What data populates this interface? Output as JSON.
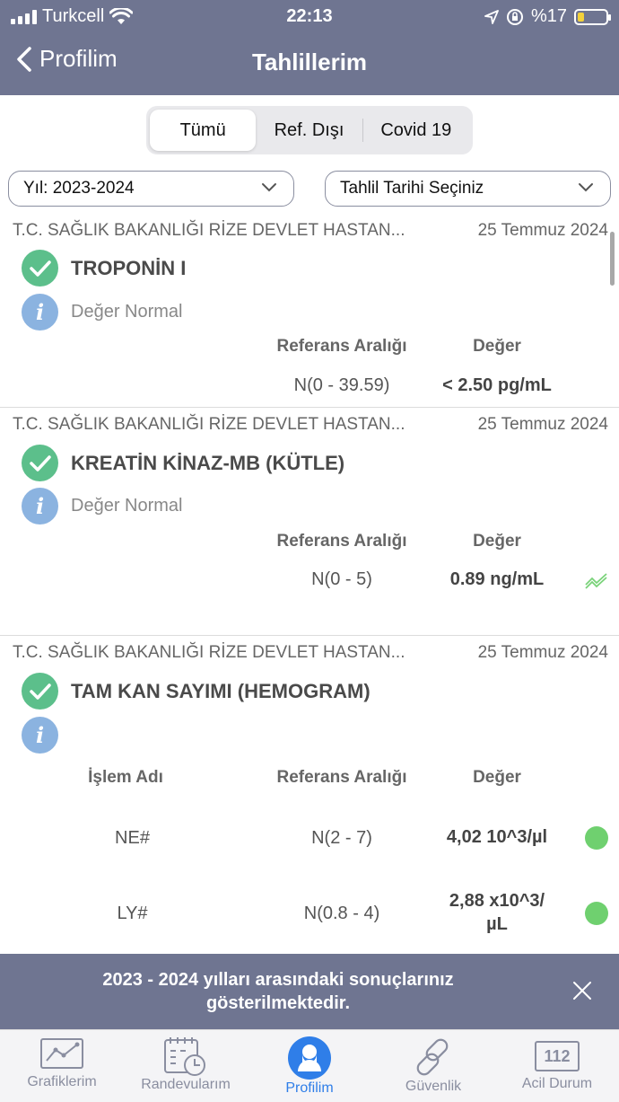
{
  "status_bar": {
    "carrier": "Turkcell",
    "time": "22:13",
    "battery": "%17"
  },
  "nav": {
    "back_label": "Profilim",
    "title": "Tahlillerim"
  },
  "segments": [
    {
      "label": "Tümü",
      "active": true
    },
    {
      "label": "Ref. Dışı",
      "active": false
    },
    {
      "label": "Covid 19",
      "active": false
    }
  ],
  "filters": {
    "year": "Yıl: 2023-2024",
    "date": "Tahlil Tarihi Seçiniz"
  },
  "results": [
    {
      "hospital": "T.C. SAĞLIK BAKANLIĞI RİZE DEVLET HASTAN...",
      "date": "25 Temmuz 2024",
      "test": "TROPONİN I",
      "status": "Değer Normal",
      "ref_header": "Referans Aralığı",
      "value_header": "Değer",
      "ref": "N(0 - 39.59)",
      "value": "< 2.50 pg/mL"
    },
    {
      "hospital": "T.C. SAĞLIK BAKANLIĞI RİZE DEVLET HASTAN...",
      "date": "25 Temmuz 2024",
      "test": "KREATİN KİNAZ-MB (KÜTLE)",
      "status": "Değer Normal",
      "ref_header": "Referans Aralığı",
      "value_header": "Değer",
      "ref": "N(0 - 5)",
      "value": "0.89 ng/mL"
    },
    {
      "hospital": "T.C. SAĞLIK BAKANLIĞI RİZE DEVLET HASTAN...",
      "date": "25 Temmuz 2024",
      "test": "TAM KAN SAYIMI (HEMOGRAM)",
      "name_header": "İşlem Adı",
      "ref_header": "Referans Aralığı",
      "value_header": "Değer",
      "rows": [
        {
          "name": "NE#",
          "ref": "N(2 - 7)",
          "value": "4,02 10^3/µl"
        },
        {
          "name": "LY#",
          "ref": "N(0.8 - 4)",
          "value_line1": "2,88 x10^3/",
          "value_line2": "µL"
        }
      ]
    }
  ],
  "banner": {
    "text": "2023 - 2024 yılları arasındaki sonuçlarınız gösterilmektedir."
  },
  "tabs": [
    {
      "label": "Grafiklerim",
      "icon": "chart-icon"
    },
    {
      "label": "Randevularım",
      "icon": "calendar-clock-icon"
    },
    {
      "label": "Profilim",
      "icon": "user-icon",
      "active": true
    },
    {
      "label": "Güvenlik",
      "icon": "link-icon"
    },
    {
      "label": "Acil Durum",
      "icon": "emergency-112-icon",
      "badge": "112"
    }
  ],
  "colors": {
    "header": "#6f7591",
    "check": "#5cbf8b",
    "info": "#8bb3e0",
    "active_tab": "#2f7ee8",
    "dot_normal": "#6fd06f"
  }
}
